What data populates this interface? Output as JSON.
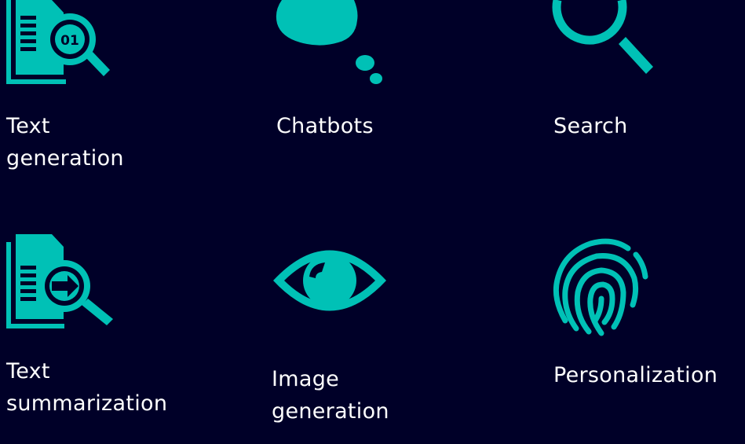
{
  "accent_color": "#00C1B6",
  "background_color": "#000028",
  "tiles": [
    {
      "label": "Text\ngeneration",
      "icon": "document-search-01-icon"
    },
    {
      "label": "Chatbots",
      "icon": "thought-bubble-icon"
    },
    {
      "label": "Search",
      "icon": "magnifier-icon"
    },
    {
      "label": "Text\nsummarization",
      "icon": "document-search-arrow-icon"
    },
    {
      "label": "Image\ngeneration",
      "icon": "eye-icon"
    },
    {
      "label": "Personalization",
      "icon": "fingerprint-icon"
    }
  ]
}
